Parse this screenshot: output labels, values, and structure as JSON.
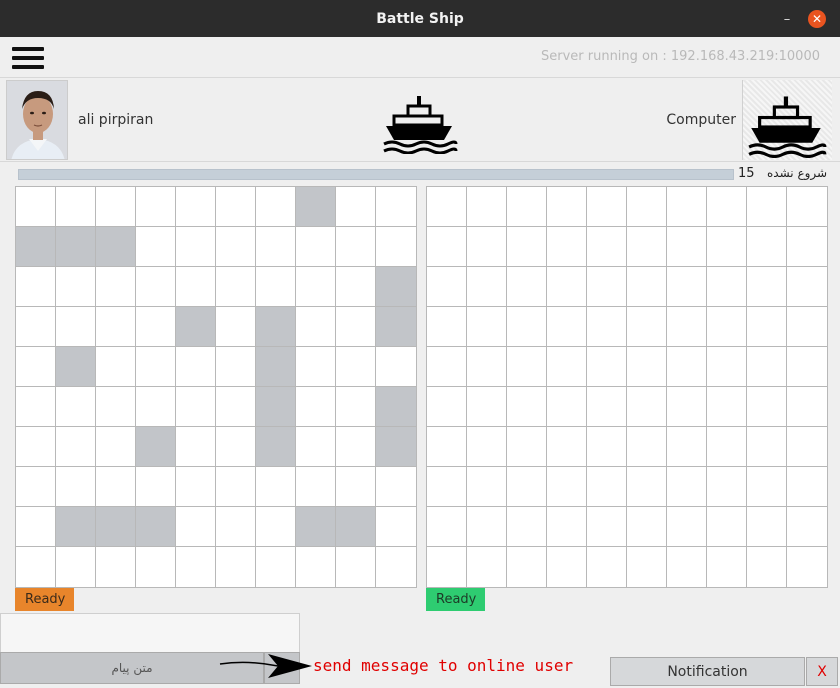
{
  "window": {
    "title": "Battle Ship",
    "minimize_label": "–",
    "close_label": "✕"
  },
  "topbar": {
    "server_status": "Server running on : 192.168.43.219:10000"
  },
  "players": {
    "player_name": "ali pirpiran",
    "opponent_name": "Computer"
  },
  "status": {
    "count": "15",
    "label": "شروع نشده"
  },
  "boards": {
    "player_ships": [
      [
        0,
        7
      ],
      [
        1,
        0
      ],
      [
        1,
        1
      ],
      [
        1,
        2
      ],
      [
        2,
        9
      ],
      [
        3,
        9
      ],
      [
        3,
        4
      ],
      [
        3,
        6
      ],
      [
        4,
        6
      ],
      [
        5,
        6
      ],
      [
        6,
        6
      ],
      [
        4,
        1
      ],
      [
        5,
        9
      ],
      [
        6,
        9
      ],
      [
        6,
        3
      ],
      [
        8,
        1
      ],
      [
        8,
        2
      ],
      [
        8,
        3
      ],
      [
        8,
        7
      ],
      [
        8,
        8
      ]
    ],
    "opponent_ships": []
  },
  "buttons": {
    "ready_left": "Ready",
    "ready_right": "Ready"
  },
  "chat": {
    "input_placeholder": "متن پیام",
    "hint": "send message to online user"
  },
  "notification": {
    "label": "Notification",
    "close_label": "X"
  },
  "colors": {
    "ready_left": "#e8852b",
    "ready_right": "#2ecc71",
    "ship_cell": "#c2c5c9",
    "hint": "#e00000"
  }
}
